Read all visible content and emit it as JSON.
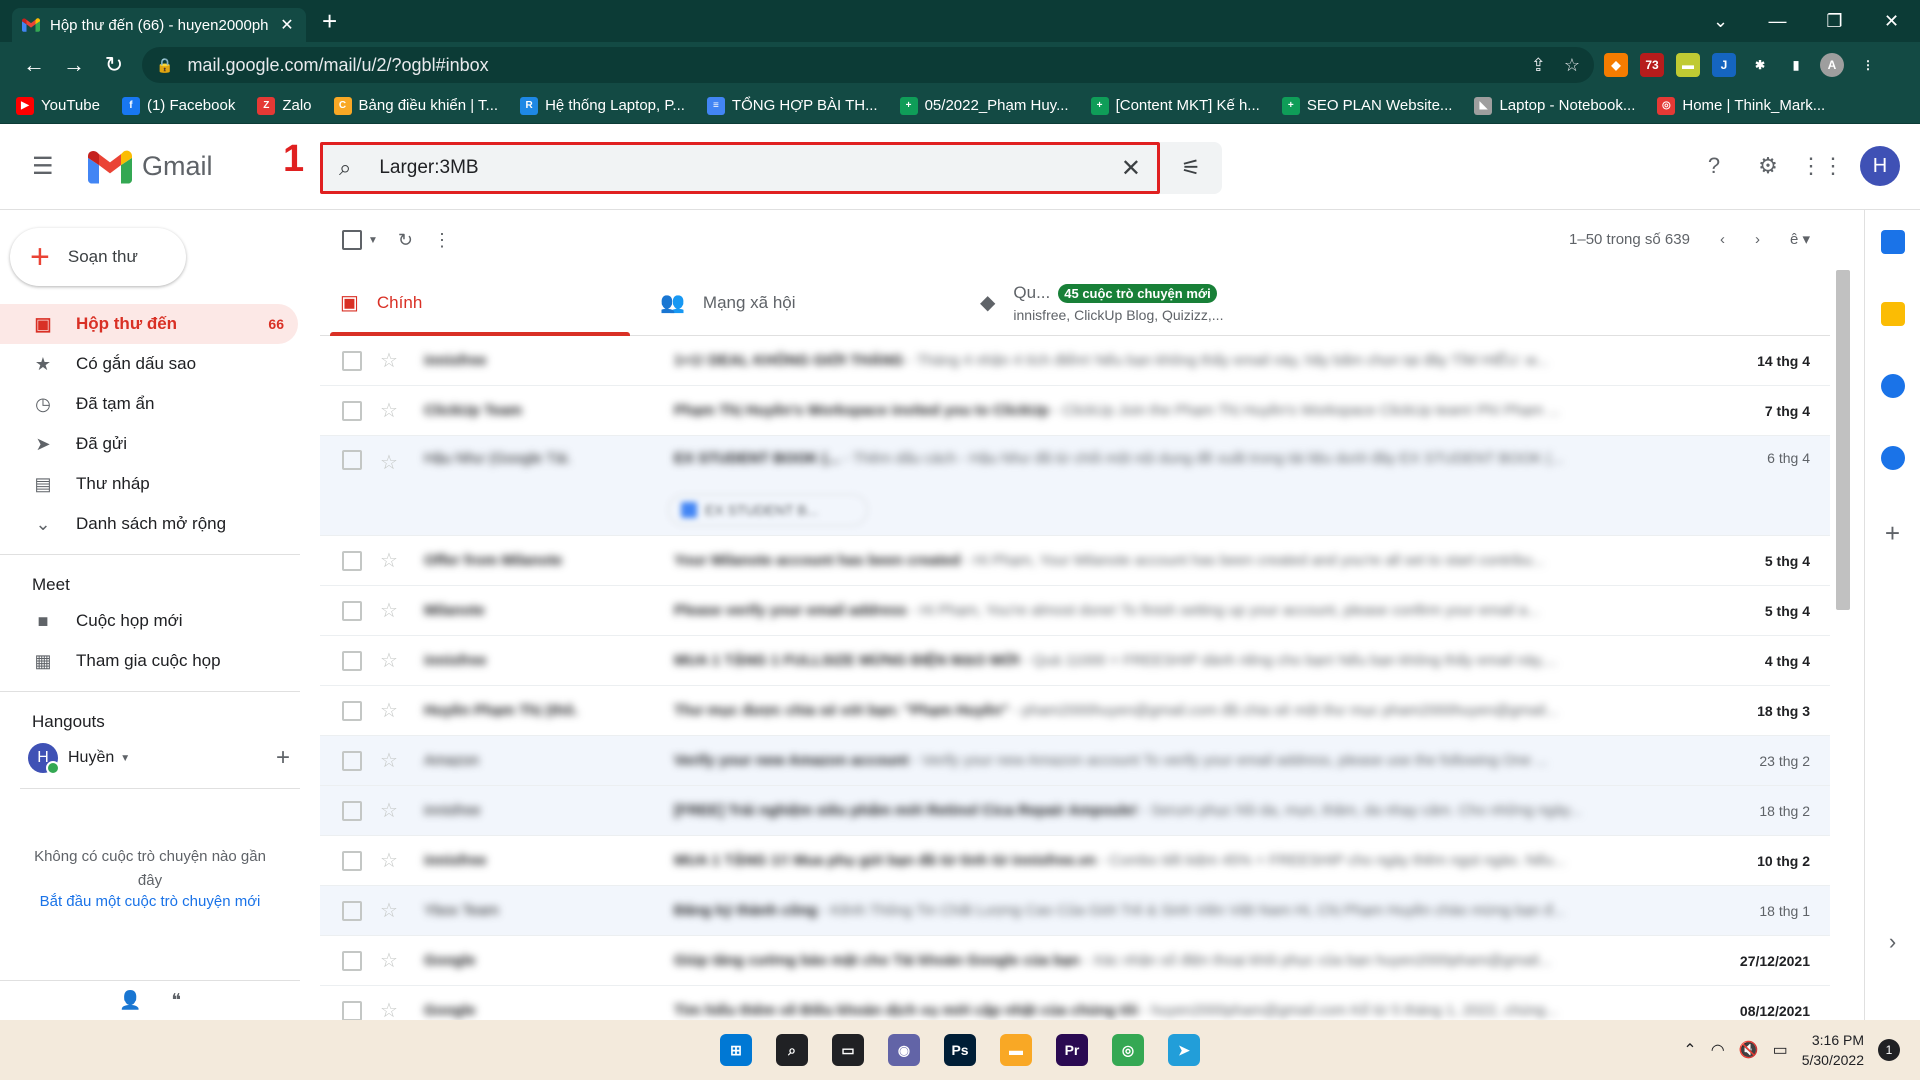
{
  "browser": {
    "tab_title": "Hộp thư đến (66) - huyen2000ph",
    "url": "mail.google.com/mail/u/2/?ogbl#inbox",
    "bookmarks": [
      {
        "label": "YouTube",
        "color": "#ff0000",
        "glyph": "▶"
      },
      {
        "label": "(1) Facebook",
        "color": "#1877f2",
        "glyph": "f"
      },
      {
        "label": "Zalo",
        "color": "#e53935",
        "glyph": "Z"
      },
      {
        "label": "Bảng điều khiển | T...",
        "color": "#f9a825",
        "glyph": "C"
      },
      {
        "label": "Hệ thống Laptop, P...",
        "color": "#1e88e5",
        "glyph": "R"
      },
      {
        "label": "TỔNG HỢP BÀI TH...",
        "color": "#4285f4",
        "glyph": "≡"
      },
      {
        "label": "05/2022_Phạm Huy...",
        "color": "#0f9d58",
        "glyph": "+"
      },
      {
        "label": "[Content MKT] Kế h...",
        "color": "#0f9d58",
        "glyph": "+"
      },
      {
        "label": "SEO PLAN Website...",
        "color": "#0f9d58",
        "glyph": "+"
      },
      {
        "label": "Laptop - Notebook...",
        "color": "#9e9e9e",
        "glyph": "◣"
      },
      {
        "label": "Home | Think_Mark...",
        "color": "#e53935",
        "glyph": "◎"
      }
    ]
  },
  "gmail": {
    "logo_text": "Gmail",
    "step_label": "1",
    "search_value": "Larger:3MB",
    "compose_label": "Soạn thư",
    "nav": [
      {
        "label": "Hộp thư đến",
        "count": "66",
        "icon": "inbox-icon",
        "glyph": "▣",
        "active": true
      },
      {
        "label": "Có gắn dấu sao",
        "count": "",
        "icon": "star-icon",
        "glyph": "★",
        "active": false
      },
      {
        "label": "Đã tạm ẩn",
        "count": "",
        "icon": "clock-icon",
        "glyph": "◷",
        "active": false
      },
      {
        "label": "Đã gửi",
        "count": "",
        "icon": "send-icon",
        "glyph": "➤",
        "active": false
      },
      {
        "label": "Thư nháp",
        "count": "",
        "icon": "draft-icon",
        "glyph": "▤",
        "active": false
      },
      {
        "label": "Danh sách mở rộng",
        "count": "",
        "icon": "chevron-down-icon",
        "glyph": "⌄",
        "active": false
      }
    ],
    "meet_title": "Meet",
    "meet_items": [
      {
        "label": "Cuộc họp mới",
        "icon": "video-icon",
        "glyph": "■"
      },
      {
        "label": "Tham gia cuộc họp",
        "icon": "keyboard-icon",
        "glyph": "▦"
      }
    ],
    "hangouts_title": "Hangouts",
    "hangouts_user": "Huyền",
    "hangouts_avatar": "H",
    "no_chat": "Không có cuộc trò chuyện nào gần đây",
    "start_chat": "Bắt đầu một cuộc trò chuyện mới",
    "pager": "1–50 trong số 639",
    "tabs": [
      {
        "label": "Chính",
        "icon": "inbox-tab-icon",
        "glyph": "▣",
        "sub": "",
        "badge": ""
      },
      {
        "label": "Mạng xã hội",
        "icon": "people-icon",
        "glyph": "👥",
        "sub": "",
        "badge": ""
      },
      {
        "label": "Qu...",
        "icon": "tag-icon",
        "glyph": "◆",
        "sub": "innisfree, ClickUp Blog, Quizizz,...",
        "badge": "45 cuộc trò chuyện mới"
      }
    ],
    "avatar_letter": "H",
    "emails": [
      {
        "from": "innisfree",
        "subject": "1+1! DEAL KHÔNG GIỚI THÁNG",
        "snippet": " - Tháng 4 nhận 4 tích điểm! Nếu bạn không thấy email này, hãy bấm chọn tại đây TÌM HIỂU: w...",
        "date": "14 thg 4",
        "unread": true
      },
      {
        "from": "ClickUp Team",
        "subject": "Phạm Thị Huyền's Workspace invited you to ClickUp",
        "snippet": " - ClickUp Join the Phạm Thị Huyền's Workspace ClickUp team! Phí Phạm ...",
        "date": "7 thg 4",
        "unread": true
      },
      {
        "from": "Hậu Như (Google Tài.",
        "subject": "EX STUDENT BOOK (...",
        "snippet": " - Thêm dấu cách - Hậu Như đã từ chối một nội dung đề xuất trong tài liệu dưới đây EX STUDENT BOOK (...",
        "date": "6 thg 4",
        "unread": false,
        "chip": "EX STUDENT B..."
      },
      {
        "from": "Offer from Milanote",
        "subject": "Your Milanote account has been created",
        "snippet": " - Hi Phạm, Your Milanote account has been created and you're all set to start contribu...",
        "date": "5 thg 4",
        "unread": true
      },
      {
        "from": "Milanote",
        "subject": "Please verify your email address",
        "snippet": " - Hi Phạm, You're almost done! To finish setting up your account, please confirm your email a...",
        "date": "5 thg 4",
        "unread": true
      },
      {
        "from": "innisfree",
        "subject": "MUA 1 TẶNG 1 FULLSIZE MỪNG ĐIỆN MẠO MỚI",
        "snippet": " - Quà 11000 + FREESHIP dành riêng cho bạn! Nếu bạn không thấy email này,...",
        "date": "4 thg 4",
        "unread": true
      },
      {
        "from": "Huyền Phạm Thị (thô.",
        "subject": "Thư mục được chia sẻ với bạn: \"Phạm Huyền\"",
        "snippet": " - pham2000huyen@gmail.com đã chia sẻ một thư mục pham2000huyen@gmail...",
        "date": "18 thg 3",
        "unread": true
      },
      {
        "from": "Amazon",
        "subject": "Verify your new Amazon account",
        "snippet": " - Verify your new Amazon account To verify your email address, please use the following One ...",
        "date": "23 thg 2",
        "unread": false
      },
      {
        "from": "innisfree",
        "subject": "[FREE] Trải nghiệm siêu phẩm mới Retinol Cica Repair Ampoule!",
        "snippet": " - Serum phục hồi da, mụn, thâm, da nhạy cảm. Cho những ngày...",
        "date": "18 thg 2",
        "unread": false
      },
      {
        "from": "innisfree",
        "subject": "MUA 1 TẶNG 1!! Mua phụ gửi bạn đã từ tình từ innisfree.vn",
        "snippet": " - Combo tiết kiệm 45% + FREESHIP cho ngày thêm ngọt ngào. Nếu...",
        "date": "10 thg 2",
        "unread": true
      },
      {
        "from": "Ybox Team",
        "subject": "Đăng ký thành công",
        "snippet": " - Kênh Thông Tin Chất Lượng Cao Của Giới Trẻ & Sinh Viên Việt Nam Hi, Chị Phạm Huyền chào mừng bạn đ...",
        "date": "18 thg 1",
        "unread": false
      },
      {
        "from": "Google",
        "subject": "Giúp tăng cường bảo mật cho Tài khoản Google của bạn",
        "snippet": " - Xác nhận số điện thoại khôi phục của bạn huyen2000pham@gmail...",
        "date": "27/12/2021",
        "unread": true
      },
      {
        "from": "Google",
        "subject": "Tìm hiểu thêm về Điều khoản dịch vụ mới cập nhật của chúng tôi",
        "snippet": " - huyen2000pham@gmail.com Kể từ 5 tháng 1, 2022, chúng...",
        "date": "08/12/2021",
        "unread": true
      }
    ]
  },
  "taskbar": {
    "time": "3:16 PM",
    "date": "5/30/2022",
    "notif_count": "1",
    "apps": [
      {
        "name": "windows-start-icon",
        "color": "#0078d4",
        "glyph": "⊞"
      },
      {
        "name": "search-icon",
        "color": "#202124",
        "glyph": "⌕"
      },
      {
        "name": "task-view-icon",
        "color": "#202124",
        "glyph": "▭"
      },
      {
        "name": "teams-icon",
        "color": "#6264a7",
        "glyph": "◉"
      },
      {
        "name": "photoshop-icon",
        "color": "#001e36",
        "glyph": "Ps"
      },
      {
        "name": "file-explorer-icon",
        "color": "#f9a825",
        "glyph": "▬"
      },
      {
        "name": "premiere-icon",
        "color": "#2a0a52",
        "glyph": "Pr"
      },
      {
        "name": "chrome-icon",
        "color": "#34a853",
        "glyph": "◎"
      },
      {
        "name": "telegram-icon",
        "color": "#229ed9",
        "glyph": "➤"
      }
    ]
  }
}
